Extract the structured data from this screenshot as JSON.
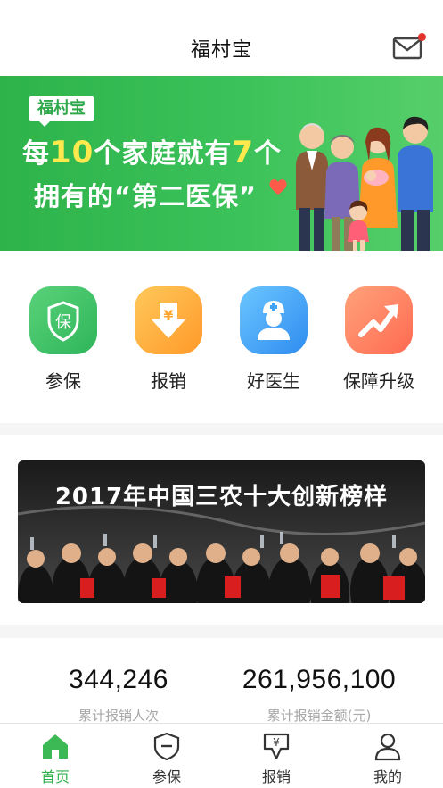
{
  "header": {
    "title": "福村宝",
    "mail_icon": "mail-icon",
    "has_unread": true
  },
  "banner": {
    "tag": "福村宝",
    "line1_pre": "每",
    "line1_num1": "10",
    "line1_mid": "个家庭就有",
    "line1_num2": "7",
    "line1_post": "个",
    "line2": "拥有的“第二医保”",
    "highlight_color": "#ffe94d",
    "background_color": "#3cc25a"
  },
  "quick_actions": [
    {
      "label": "参保",
      "icon": "shield-icon",
      "color": "#3cc25a"
    },
    {
      "label": "报销",
      "icon": "yuan-download-icon",
      "color": "#ffad3a"
    },
    {
      "label": "好医生",
      "icon": "doctor-icon",
      "color": "#3fa3f5"
    },
    {
      "label": "保障升级",
      "icon": "trend-up-icon",
      "color": "#ff7a5e"
    }
  ],
  "promo": {
    "title": "2017年中国三农十大创新榜样"
  },
  "stats": [
    {
      "value": "344,246",
      "label": "累计报销人次"
    },
    {
      "value": "261,956,100",
      "label": "累计报销金额(元)"
    }
  ],
  "tabbar": {
    "items": [
      {
        "label": "首页",
        "icon": "home-icon",
        "active": true
      },
      {
        "label": "参保",
        "icon": "shield-minus-icon",
        "active": false
      },
      {
        "label": "报销",
        "icon": "yuan-receipt-icon",
        "active": false
      },
      {
        "label": "我的",
        "icon": "user-icon",
        "active": false
      }
    ],
    "active_color": "#2fb04a"
  }
}
